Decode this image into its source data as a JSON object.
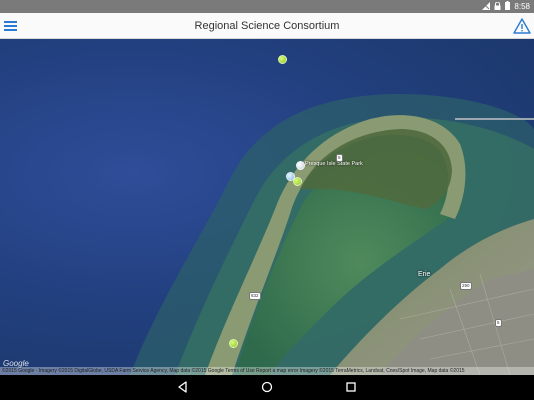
{
  "status_bar": {
    "time": "8:58",
    "icons": [
      "no-sim-icon",
      "lock-icon",
      "battery-icon"
    ]
  },
  "app_bar": {
    "title": "Regional Science Consortium",
    "menu_icon": "hamburger-menu-icon",
    "alert_icon": "warning-triangle-icon",
    "accent_color": "#2a7bd3"
  },
  "map": {
    "type": "satellite",
    "park_label": "Presque Isle State Park",
    "city_label": "Erie",
    "road_shields": [
      "832",
      "5",
      "290",
      "5"
    ],
    "markers": [
      {
        "name": "marker-offshore",
        "color": "green"
      },
      {
        "name": "marker-beach-white",
        "color": "white"
      },
      {
        "name": "marker-beach-blue",
        "color": "blue"
      },
      {
        "name": "marker-beach-green",
        "color": "green"
      },
      {
        "name": "marker-south-green",
        "color": "green"
      }
    ],
    "google_logo": "Google",
    "attribution": "©2015 Google · Imagery ©2015 DigitalGlobe, USDA Farm Service Agency, Map data ©2015 Google  Terms of Use  Report a map error  Imagery ©2015 TerraMetrics, Landsat, Cnes/Spot Image, Map data ©2015"
  },
  "nav_bar": {
    "buttons": [
      "back-icon",
      "home-icon",
      "recents-icon"
    ]
  }
}
